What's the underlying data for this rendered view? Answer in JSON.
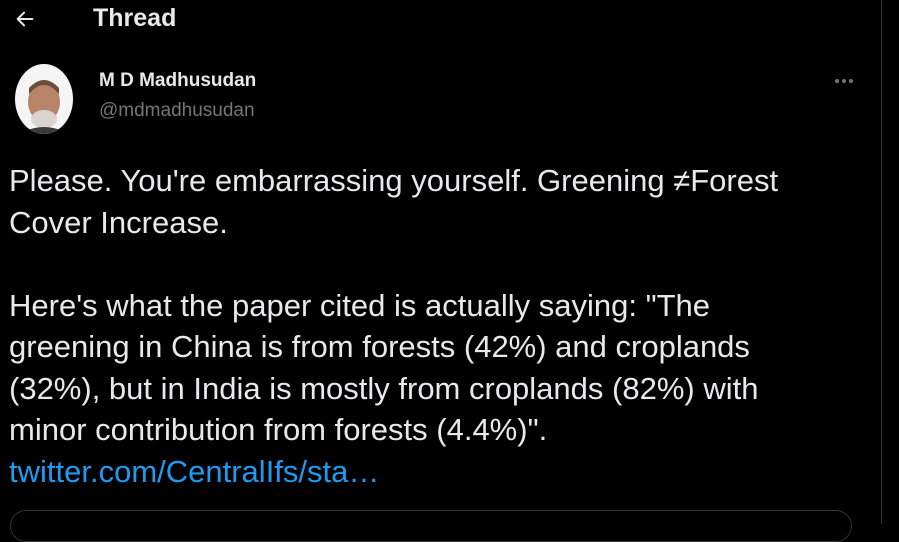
{
  "header": {
    "title": "Thread",
    "back_icon": "arrow-left-icon"
  },
  "author": {
    "name": "M D Madhusudan",
    "handle": "@mdmadhusudan",
    "avatar_icon": "avatar"
  },
  "menu": {
    "icon": "more-horizontal-icon"
  },
  "tweet": {
    "line1": "Please. You're embarrassing yourself. Greening ≠Forest",
    "line2": "Cover Increase.",
    "line3": "Here's what the paper cited is actually saying: \"The",
    "line4": "greening in China is from forests (42%) and croplands",
    "line5": "(32%), but in India is mostly from croplands (82%) with",
    "line6": "minor contribution from forests (4.4%)\".",
    "link": "twitter.com/CentralIfs/sta…"
  },
  "colors": {
    "background": "#000000",
    "text": "#e7e9ea",
    "muted": "#71767b",
    "link": "#1d9bf0",
    "border": "#2f3336"
  }
}
